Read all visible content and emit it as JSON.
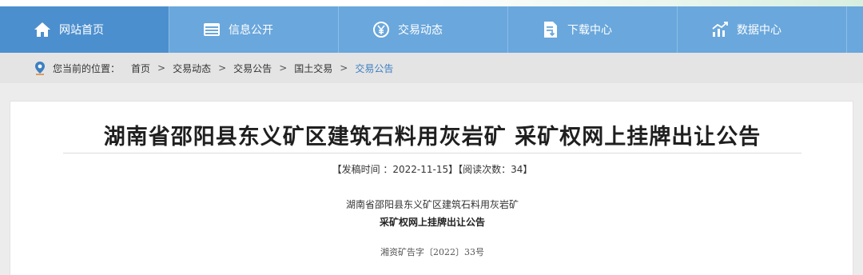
{
  "nav": {
    "items": [
      {
        "label": "网站首页",
        "icon": "home-icon"
      },
      {
        "label": "信息公开",
        "icon": "document-list-icon"
      },
      {
        "label": "交易动态",
        "icon": "yen-circle-icon"
      },
      {
        "label": "下载中心",
        "icon": "download-document-icon"
      },
      {
        "label": "数据中心",
        "icon": "chart-trend-icon"
      }
    ]
  },
  "breadcrumb": {
    "prefix": "您当前的位置：",
    "items": [
      "首页",
      "交易动态",
      "交易公告",
      "国土交易",
      "交易公告"
    ],
    "separator": ">"
  },
  "article": {
    "title": "湖南省邵阳县东义矿区建筑石料用灰岩矿 采矿权网上挂牌出让公告",
    "meta": "【发稿时间 ：2022-11-15】【阅读次数：34】",
    "doc_line1": "湖南省邵阳县东义矿区建筑石料用灰岩矿",
    "doc_line2": "采矿权网上挂牌出让公告",
    "doc_number": "湘资矿告字〔2022〕33号"
  },
  "colors": {
    "nav_bg": "#6aa7dc",
    "nav_active": "#4c8fce",
    "link_active": "#3d7fc2",
    "crumb_bg": "#e4e4e4"
  }
}
